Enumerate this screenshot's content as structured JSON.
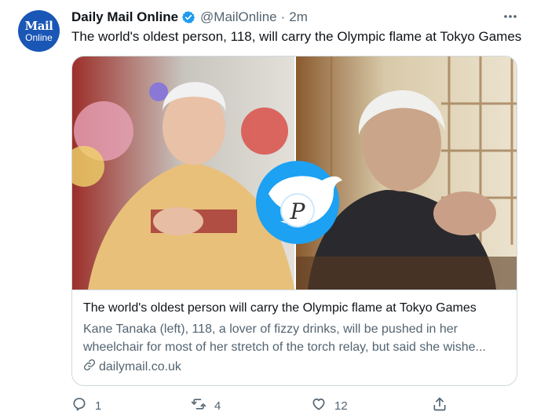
{
  "tweet": {
    "avatar": {
      "line1": "Mail",
      "line2": "Online",
      "color": "#1a56b5"
    },
    "display_name": "Daily Mail Online",
    "verified_icon": "verified-badge-icon",
    "handle": "@MailOnline",
    "separator": "·",
    "time": "2m",
    "more_icon": "more-options-icon",
    "text": "The world's oldest person, 118, will carry the Olympic flame at Tokyo Games"
  },
  "card": {
    "title": "The world's oldest person will carry the Olympic flame at Tokyo Games",
    "description": "Kane Tanaka (left), 118, a lover of fizzy drinks, will be pushed in her wheelchair for most of her stretch of the torch relay, but said she wishe...",
    "link_icon": "link-icon",
    "domain": "dailymail.co.uk"
  },
  "actions": {
    "reply": {
      "icon": "reply-icon",
      "count": "1"
    },
    "retweet": {
      "icon": "retweet-icon",
      "count": "4"
    },
    "like": {
      "icon": "heart-icon",
      "count": "12"
    },
    "share": {
      "icon": "share-icon"
    }
  },
  "colors": {
    "text": "#0f1419",
    "muted": "#536471",
    "verified": "#1d9bf0",
    "border": "#cfd9de"
  }
}
